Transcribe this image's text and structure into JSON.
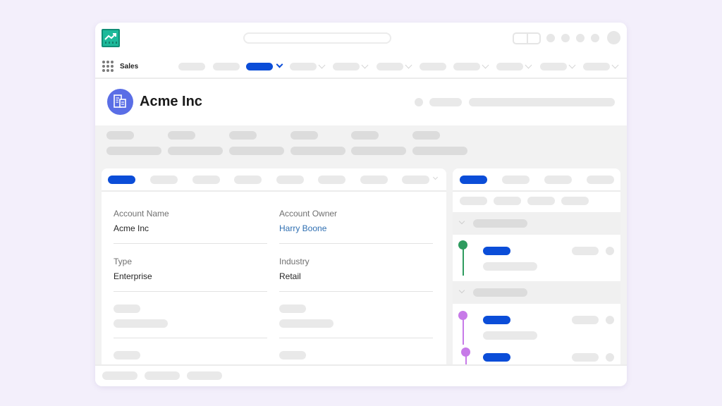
{
  "app": {
    "name": "Sales",
    "logo_icon": "trending-chart-icon",
    "brand_color": "#1db99a",
    "accent_color": "#0b4dd8"
  },
  "record": {
    "title": "Acme Inc",
    "icon": "building-icon",
    "icon_color": "#5a6ee6"
  },
  "details": {
    "fields": [
      {
        "label": "Account Name",
        "value": "Acme Inc",
        "is_link": false
      },
      {
        "label": "Account Owner",
        "value": "Harry Boone",
        "is_link": true
      },
      {
        "label": "Type",
        "value": "Enterprise",
        "is_link": false
      },
      {
        "label": "Industry",
        "value": "Retail",
        "is_link": false
      }
    ]
  },
  "activity": {
    "timeline_colors": [
      "#2e9b5f",
      "#c77ae8"
    ]
  }
}
